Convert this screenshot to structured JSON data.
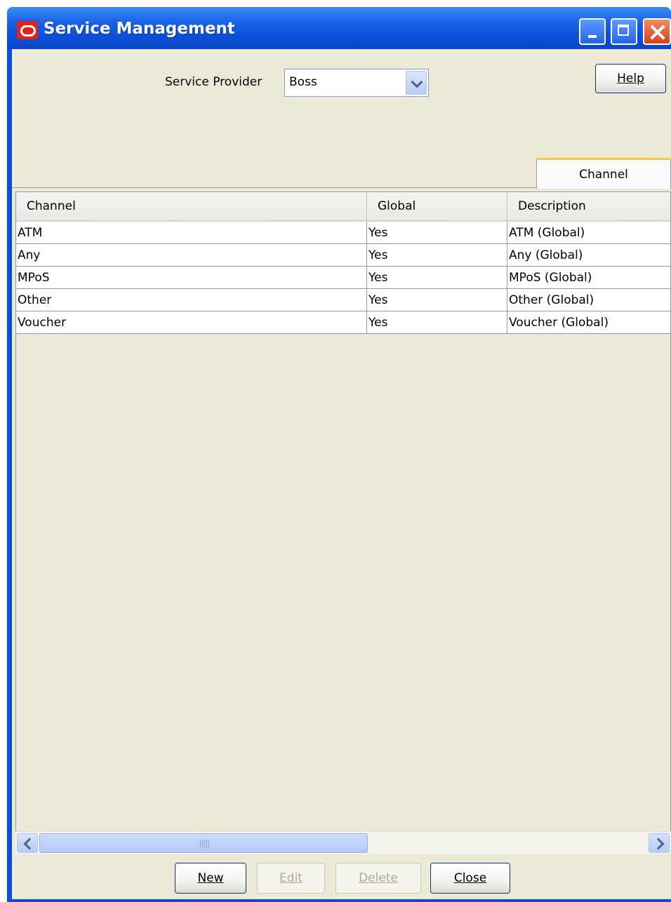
{
  "window": {
    "title": "Service Management"
  },
  "service_provider": {
    "label": "Service Provider",
    "value": "Boss"
  },
  "help_label": "Help",
  "tabs": [
    {
      "label": "Channel",
      "selected": true
    }
  ],
  "table": {
    "columns": [
      "Channel",
      "Global",
      "Description"
    ],
    "rows": [
      {
        "channel": "ATM",
        "global": "Yes",
        "description": "ATM (Global)"
      },
      {
        "channel": "Any",
        "global": "Yes",
        "description": "Any (Global)"
      },
      {
        "channel": "MPoS",
        "global": "Yes",
        "description": "MPoS (Global)"
      },
      {
        "channel": "Other",
        "global": "Yes",
        "description": "Other (Global)"
      },
      {
        "channel": "Voucher",
        "global": "Yes",
        "description": "Voucher (Global)"
      }
    ]
  },
  "buttons": {
    "new": {
      "label": "New",
      "enabled": true
    },
    "edit": {
      "label": "Edit",
      "enabled": false
    },
    "delete": {
      "label": "Delete",
      "enabled": false
    },
    "close": {
      "label": "Close",
      "enabled": true
    }
  },
  "icons": {
    "app": "oracle-logo-icon",
    "minimize": "minimize-icon",
    "maximize": "maximize-icon",
    "close": "close-icon",
    "dropdown": "chevron-down-icon",
    "scroll_left": "scroll-left-icon",
    "scroll_right": "scroll-right-icon"
  },
  "colors": {
    "titlebar": "#0a4fd6",
    "window_bg": "#ece9d8",
    "tab_highlight": "#ffc83c"
  }
}
